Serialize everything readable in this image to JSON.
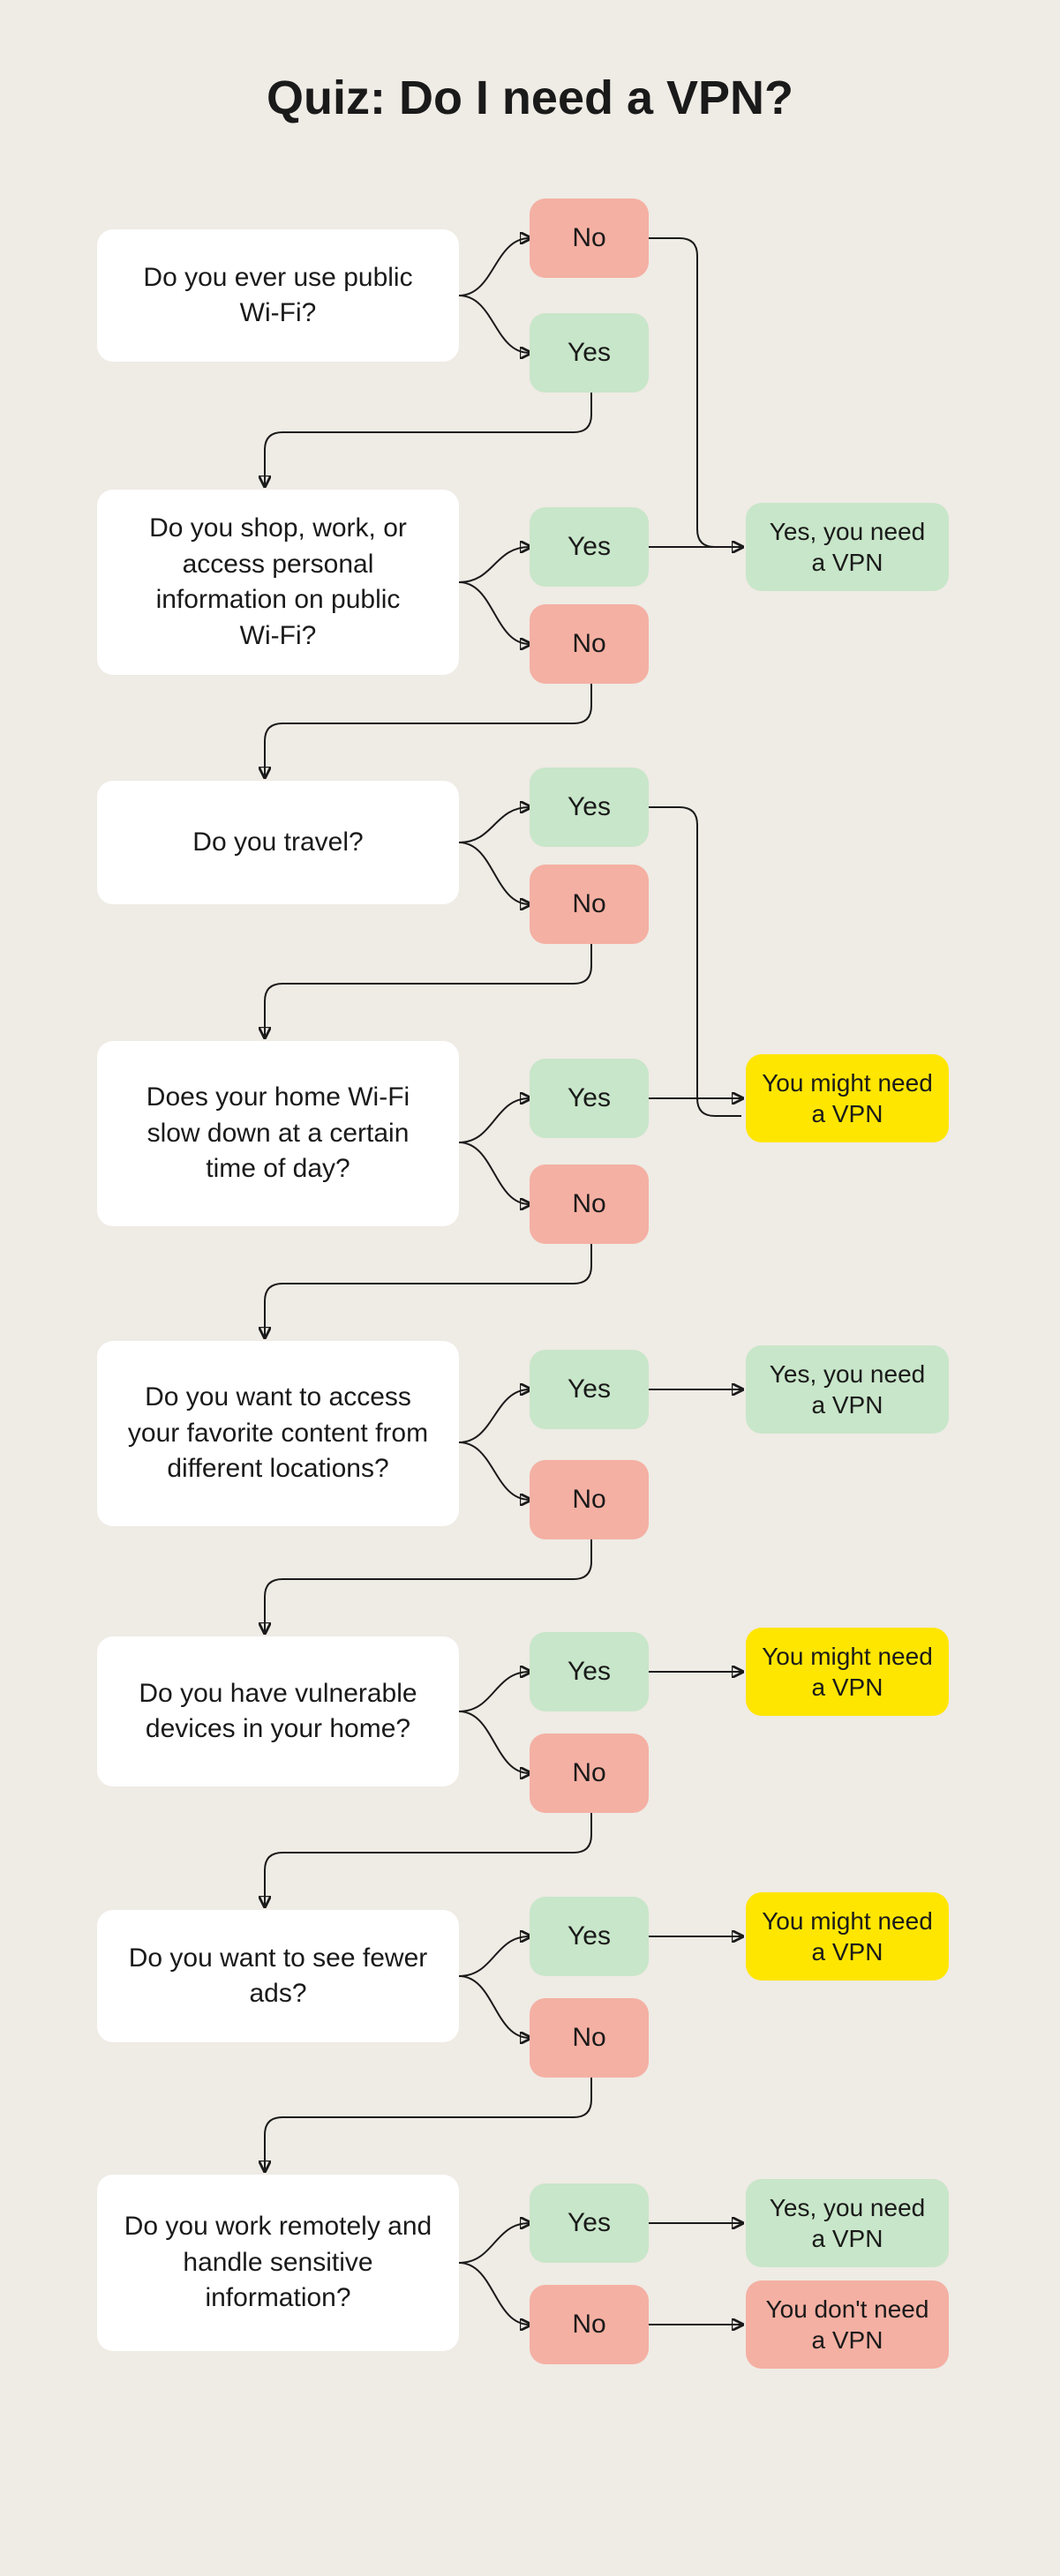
{
  "title": "Quiz: Do I need a VPN?",
  "labels": {
    "yes": "Yes",
    "no": "No"
  },
  "results": {
    "need": "Yes, you need a VPN",
    "might": "You might need a VPN",
    "dont": "You don't need a VPN"
  },
  "questions": {
    "q1": "Do you ever use public Wi-Fi?",
    "q2": "Do you shop, work, or access personal information on public Wi‑Fi?",
    "q3": "Do you travel?",
    "q4": "Does your home Wi‑Fi slow down at a certain time of day?",
    "q5": "Do you want to access your favorite content from different locations?",
    "q6": "Do you have vulnerable devices in your home?",
    "q7": "Do you want to see fewer ads?",
    "q8": "Do you work remotely and handle sensitive information?"
  },
  "flow": {
    "q1": {
      "yes": "q2",
      "no": "q2"
    },
    "q2": {
      "yes": "result_need",
      "no": "q3"
    },
    "q3": {
      "yes": "q4",
      "no": "q4"
    },
    "q4": {
      "yes": "result_might",
      "no": "q5"
    },
    "q5": {
      "yes": "result_need",
      "no": "q6"
    },
    "q6": {
      "yes": "result_might",
      "no": "q7"
    },
    "q7": {
      "yes": "result_might",
      "no": "q8"
    },
    "q8": {
      "yes": "result_need",
      "no": "result_dont"
    }
  }
}
